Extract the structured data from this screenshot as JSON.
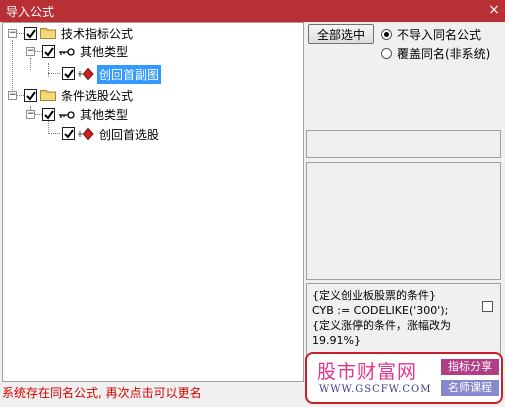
{
  "window": {
    "title": "导入公式",
    "close_glyph": "×"
  },
  "tree": {
    "nodes": [
      {
        "label": "技术指标公式",
        "checked": true,
        "expanded": true,
        "icon": "folder-icon"
      },
      {
        "label": "其他类型",
        "checked": true,
        "expanded": true,
        "icon": "key-icon"
      },
      {
        "label": "创回首副图",
        "checked": true,
        "selected": true,
        "icon": "formula-icon"
      },
      {
        "label": "条件选股公式",
        "checked": true,
        "expanded": true,
        "icon": "folder-icon"
      },
      {
        "label": "其他类型",
        "checked": true,
        "expanded": true,
        "icon": "key-icon"
      },
      {
        "label": "创回首选股",
        "checked": true,
        "icon": "formula-icon"
      }
    ],
    "expander_glyph": "−"
  },
  "controls": {
    "select_all_label": "全部选中",
    "options": [
      {
        "label": "不导入同名公式",
        "selected": true
      },
      {
        "label": "覆盖同名(非系统)",
        "selected": false
      }
    ]
  },
  "preview": {
    "lines": [
      "{定义创业板股票的条件}",
      "CYB := CODELIKE('300');",
      "{定义涨停的条件，涨幅改为",
      "19.91%}"
    ]
  },
  "status_text": "系统存在同名公式, 再次点击可以更名",
  "watermark": {
    "brand": "股市财富网",
    "url": "WWW.GSCFW.COM",
    "tag1": "指标分享",
    "tag2": "名师课程"
  },
  "colors": {
    "titlebar": "#b82f36",
    "selection": "#3399ff",
    "status_text": "#d40000",
    "watermark_border": "#c9202a"
  }
}
